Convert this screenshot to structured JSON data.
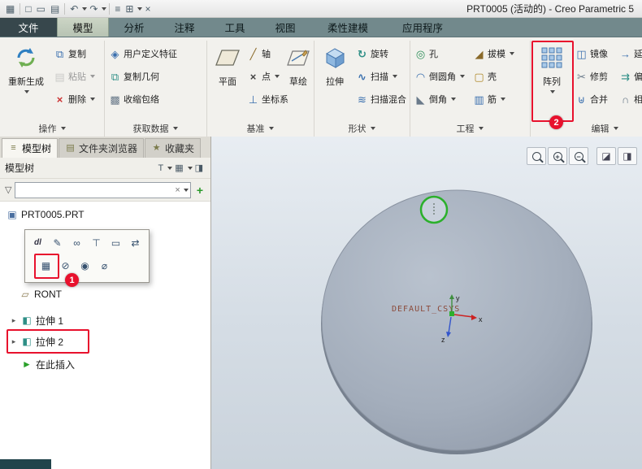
{
  "titlebar": {
    "title": "PRT0005 (活动的) - Creo Parametric 5"
  },
  "tabs": {
    "file": "文件",
    "model": "模型",
    "analysis": "分析",
    "annotate": "注释",
    "tools": "工具",
    "view": "视图",
    "flexible_modeling": "柔性建模",
    "applications": "应用程序"
  },
  "ribbon": {
    "operations": {
      "label": "操作",
      "regenerate": "重新生成",
      "copy": "复制",
      "paste": "粘贴",
      "del": "删除"
    },
    "get_data": {
      "label": "获取数据",
      "udf": "用户定义特征",
      "copy_geometry": "复制几何",
      "shrinkwrap": "收缩包络"
    },
    "datum": {
      "label": "基准",
      "plane": "平面",
      "axis": "轴",
      "point": "点",
      "csys": "坐标系",
      "sketch": "草绘"
    },
    "shapes": {
      "label": "形状",
      "extrude": "拉伸",
      "revolve": "旋转",
      "sweep": "扫描",
      "swept_blend": "扫描混合"
    },
    "engineering": {
      "label": "工程",
      "hole": "孔",
      "round": "倒圆角",
      "chamfer": "倒角",
      "draft": "拔模",
      "shell": "壳",
      "rib": "筋"
    },
    "editing": {
      "label": "编辑",
      "pattern": "阵列",
      "mirror": "镜像",
      "trim": "修剪",
      "merge": "合并",
      "extend": "延",
      "offset": "偏",
      "intersect": "相"
    }
  },
  "navigator": {
    "tab_model_tree": "模型树",
    "tab_folder_browser": "文件夹浏览器",
    "tab_favorites": "收藏夹",
    "header_title": "模型树",
    "tree": {
      "root": "PRT0005.PRT",
      "front_partial": "RONT",
      "extrude1": "拉伸 1",
      "extrude2": "拉伸 2",
      "insert_here": "在此插入"
    }
  },
  "canvas": {
    "csys_label": "DEFAULT_CSYS",
    "axis_x": "x",
    "axis_y": "y",
    "axis_z": "z"
  },
  "annotations": {
    "step1": "1",
    "step2": "2"
  },
  "icons": {
    "window": "▦",
    "new_file": "□",
    "open": "▭",
    "save": "▤",
    "undo": "↶",
    "redo": "↷",
    "list": "≡",
    "windows": "⊞",
    "close": "×",
    "copy": "⧉",
    "paste": "▤",
    "del": "×",
    "udf": "◈",
    "copy_geometry": "⧉",
    "shrinkwrap": "▩",
    "axis": "╱",
    "point": "×",
    "csys": "⊥",
    "revolve": "↻",
    "sweep": "∿",
    "swept_blend": "≋",
    "hole": "◎",
    "round": "◠",
    "chamfer": "◣",
    "draft": "◢",
    "shell": "▢",
    "rib": "▥",
    "mirror": "◫",
    "trim": "✂",
    "merge": "⊎",
    "extend": "→",
    "offset": "⇉",
    "intersect": "∩",
    "model_tree": "≡",
    "folder": "▤",
    "star": "★",
    "filter_funnel": "▽",
    "clear": "×",
    "plus": "+",
    "tree_filter": "T",
    "tree_settings": "▦",
    "tree_expand": "◨",
    "part": "▣",
    "feature": "◧",
    "datum_plane": "▱",
    "insert_arrow": "►",
    "expand_caret": "▸",
    "mini_dims": "dl",
    "mini_appearance": "✎",
    "mini_link": "∞",
    "mini_pin": "⊤",
    "mini_note": "▭",
    "mini_reorder": "⇄",
    "mini_pattern": "▦",
    "mini_suppress": "⊘",
    "mini_show": "◉",
    "mini_hide": "⌀",
    "display_style": "◪",
    "saved_views": "◨",
    "zoom_plus": "+",
    "zoom_minus": "−"
  },
  "colors": {
    "annotation_red": "#e8112d",
    "selection_green": "#2bb02b",
    "accent_blue": "#2e7fc1"
  }
}
